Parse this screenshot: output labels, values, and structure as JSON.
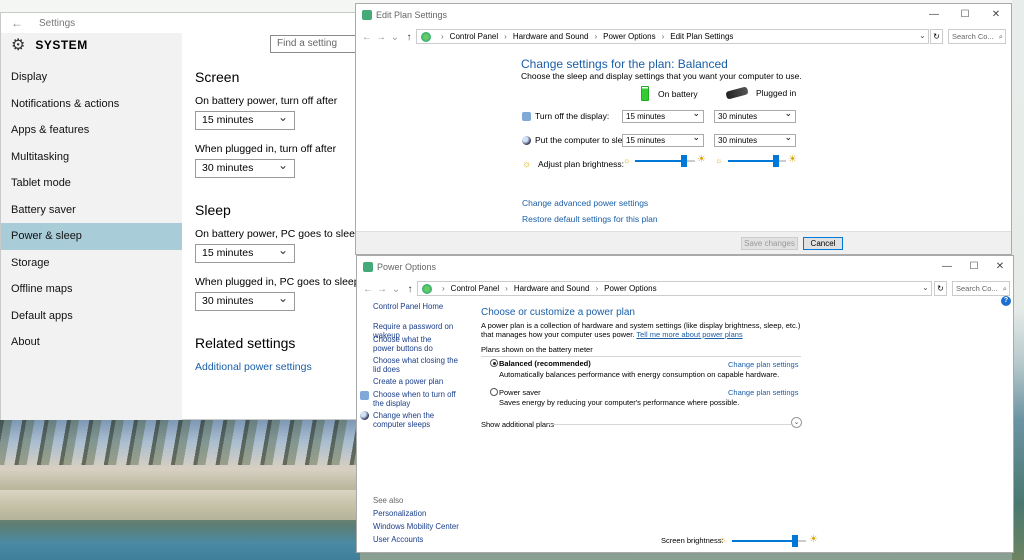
{
  "settings": {
    "title": "Settings",
    "section_title": "SYSTEM",
    "search_placeholder": "Find a setting",
    "nav": [
      {
        "label": "Display"
      },
      {
        "label": "Notifications & actions"
      },
      {
        "label": "Apps & features"
      },
      {
        "label": "Multitasking"
      },
      {
        "label": "Tablet mode"
      },
      {
        "label": "Battery saver"
      },
      {
        "label": "Power & sleep",
        "active": true
      },
      {
        "label": "Storage"
      },
      {
        "label": "Offline maps"
      },
      {
        "label": "Default apps"
      },
      {
        "label": "About"
      }
    ],
    "screen_heading": "Screen",
    "screen_battery_label": "On battery power, turn off after",
    "screen_battery_value": "15 minutes",
    "screen_plugged_label": "When plugged in, turn off after",
    "screen_plugged_value": "30 minutes",
    "sleep_heading": "Sleep",
    "sleep_battery_label": "On battery power, PC goes to sleep after",
    "sleep_battery_value": "15 minutes",
    "sleep_plugged_label": "When plugged in, PC goes to sleep after",
    "sleep_plugged_value": "30 minutes",
    "related_heading": "Related settings",
    "related_link": "Additional power settings"
  },
  "edit_plan": {
    "title": "Edit Plan Settings",
    "breadcrumb": [
      "Control Panel",
      "Hardware and Sound",
      "Power Options",
      "Edit Plan Settings"
    ],
    "search_placeholder": "Search Co...",
    "heading": "Change settings for the plan: Balanced",
    "subheading": "Choose the sleep and display settings that you want your computer to use.",
    "col_battery": "On battery",
    "col_plugged": "Plugged in",
    "row_display": "Turn off the display:",
    "row_display_battery": "15 minutes",
    "row_display_plugged": "30 minutes",
    "row_sleep": "Put the computer to sleep:",
    "row_sleep_battery": "15 minutes",
    "row_sleep_plugged": "30 minutes",
    "row_brightness": "Adjust plan brightness:",
    "brightness_battery": 0.82,
    "brightness_plugged": 0.82,
    "link_advanced": "Change advanced power settings",
    "link_restore": "Restore default settings for this plan",
    "btn_save": "Save changes",
    "btn_cancel": "Cancel"
  },
  "power_options": {
    "title": "Power Options",
    "breadcrumb": [
      "Control Panel",
      "Hardware and Sound",
      "Power Options"
    ],
    "search_placeholder": "Search Co...",
    "left_home": "Control Panel Home",
    "left_links": [
      "Require a password on wakeup",
      "Choose what the power buttons do",
      "Choose what closing the lid does",
      "Create a power plan",
      "Choose when to turn off the display",
      "Change when the computer sleeps"
    ],
    "see_also": "See also",
    "see_also_links": [
      "Personalization",
      "Windows Mobility Center",
      "User Accounts"
    ],
    "heading": "Choose or customize a power plan",
    "description": "A power plan is a collection of hardware and system settings (like display brightness, sleep, etc.) that manages how your computer uses power.",
    "description_link": "Tell me more about power plans",
    "plans_label": "Plans shown on the battery meter",
    "plans": [
      {
        "name": "Balanced (recommended)",
        "desc": "Automatically balances performance with energy consumption on capable hardware.",
        "link": "Change plan settings",
        "selected": true
      },
      {
        "name": "Power saver",
        "desc": "Saves energy by reducing your computer's performance where possible.",
        "link": "Change plan settings",
        "selected": false
      }
    ],
    "show_additional": "Show additional plans",
    "screen_brightness_label": "Screen brightness:",
    "screen_brightness": 0.85
  }
}
